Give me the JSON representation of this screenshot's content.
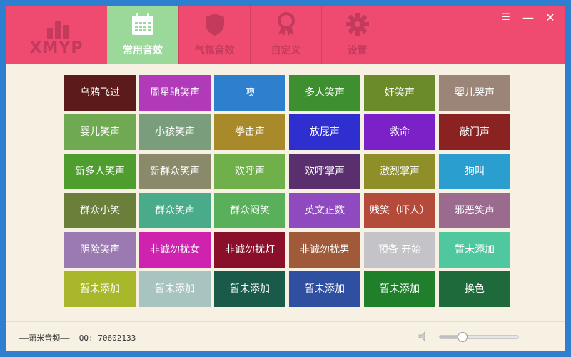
{
  "app": {
    "logo_text": "XMYP",
    "colors": {
      "header": "#ef4a70",
      "active_tab": "#9bd99b",
      "background": "#f6f1e2"
    }
  },
  "tabs": [
    {
      "label": "常用音效",
      "icon": "calendar-icon",
      "active": true
    },
    {
      "label": "气氛音效",
      "icon": "shield-icon",
      "active": false
    },
    {
      "label": "自定义",
      "icon": "award-ribbon-icon",
      "active": false
    },
    {
      "label": "设置",
      "icon": "gear-icon",
      "active": false
    }
  ],
  "window_controls": [
    {
      "name": "menu",
      "glyph": "☰"
    },
    {
      "name": "minimize",
      "glyph": "—"
    },
    {
      "name": "close",
      "glyph": "✕"
    }
  ],
  "buttons": [
    {
      "label": "乌鸦飞过",
      "color": "#5c1a1a"
    },
    {
      "label": "周星驰笑声",
      "color": "#b03ab8"
    },
    {
      "label": "噢",
      "color": "#2f7fcf"
    },
    {
      "label": "多人笑声",
      "color": "#3d8f2f"
    },
    {
      "label": "奸笑声",
      "color": "#6b8a2a"
    },
    {
      "label": "婴儿哭声",
      "color": "#9a8578"
    },
    {
      "label": "婴儿笑声",
      "color": "#6faa52"
    },
    {
      "label": "小孩笑声",
      "color": "#7a9e7c"
    },
    {
      "label": "拳击声",
      "color": "#a98a2a"
    },
    {
      "label": "放屁声",
      "color": "#2f2fcf"
    },
    {
      "label": "救命",
      "color": "#7a22c8"
    },
    {
      "label": "敲门声",
      "color": "#8a2222"
    },
    {
      "label": "新多人笑声",
      "color": "#4f9d2f"
    },
    {
      "label": "新群众笑声",
      "color": "#8a8a6a"
    },
    {
      "label": "欢呼声",
      "color": "#6fb04a"
    },
    {
      "label": "欢呼掌声",
      "color": "#5a2f6e"
    },
    {
      "label": "激烈掌声",
      "color": "#8f8f2a"
    },
    {
      "label": "狗叫",
      "color": "#2a9fcf"
    },
    {
      "label": "群众小笑",
      "color": "#6a7f3a"
    },
    {
      "label": "群众笑声",
      "color": "#4aab8a"
    },
    {
      "label": "群众闷笑",
      "color": "#5aaf5a"
    },
    {
      "label": "英文正数",
      "color": "#8f4abf"
    },
    {
      "label": "贱笑（吓人）",
      "color": "#b44a3a"
    },
    {
      "label": "邪恶笑声",
      "color": "#9a6a8f"
    },
    {
      "label": "阴险笑声",
      "color": "#9a7ab0"
    },
    {
      "label": "非诚勿扰女",
      "color": "#cf22af"
    },
    {
      "label": "非诚勿扰灯",
      "color": "#8a0f2a"
    },
    {
      "label": "非诚勿扰男",
      "color": "#a05a3a"
    },
    {
      "label": "预备 开始",
      "color": "#c4c4c8"
    },
    {
      "label": "暂未添加",
      "color": "#4fc8a0"
    },
    {
      "label": "暂未添加",
      "color": "#a8b82a"
    },
    {
      "label": "暂未添加",
      "color": "#a8c4c0"
    },
    {
      "label": "暂未添加",
      "color": "#1a5a4a"
    },
    {
      "label": "暂未添加",
      "color": "#2f4fa0"
    },
    {
      "label": "暂未添加",
      "color": "#1f7f2a"
    },
    {
      "label": "换色",
      "color": "#1f6a3a"
    }
  ],
  "footer": {
    "text": "——萧米音频——  QQ: 70602133",
    "volume_percent": 28
  }
}
